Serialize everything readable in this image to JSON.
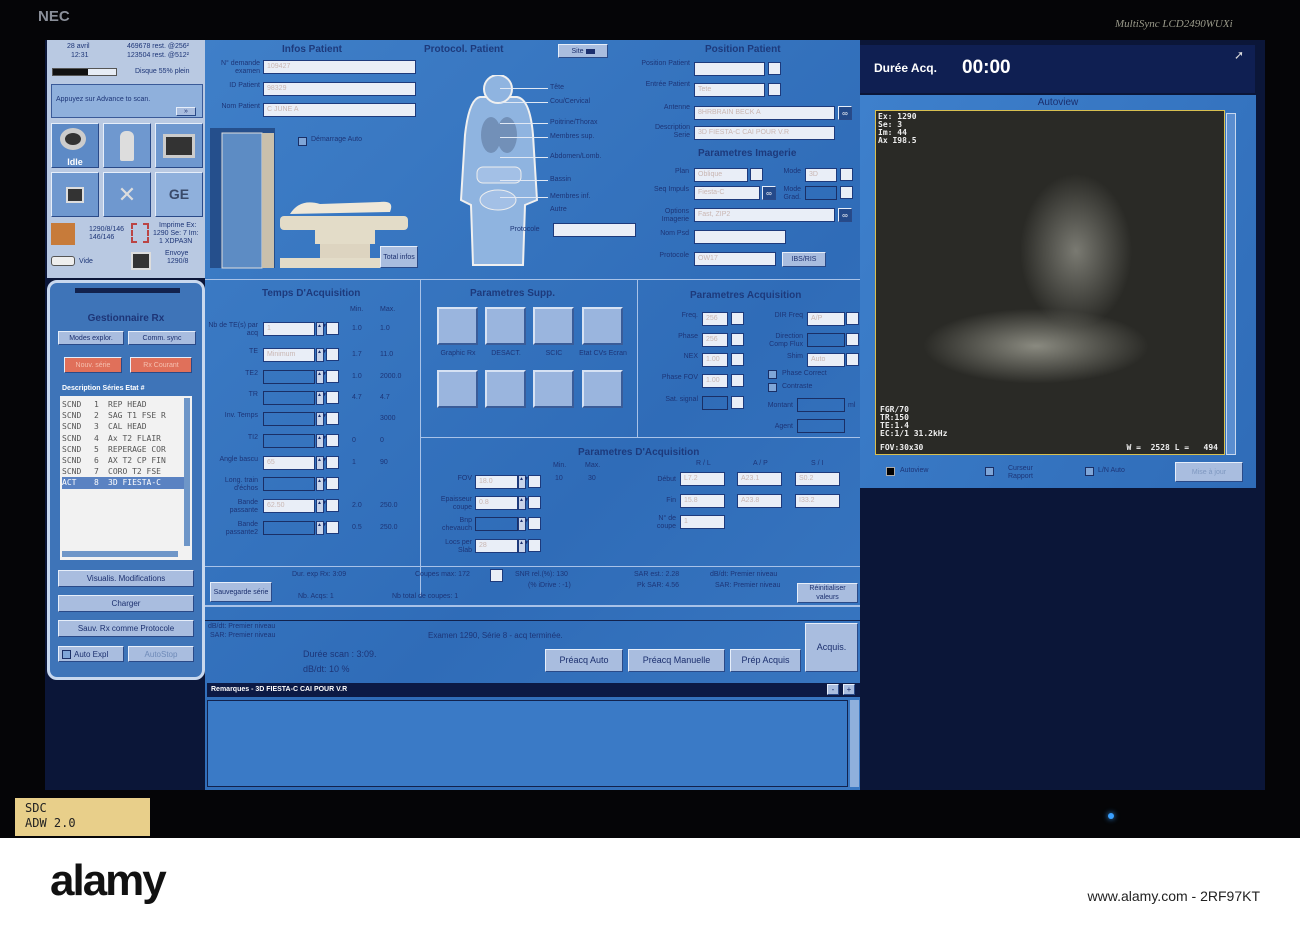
{
  "bezel": {
    "brand": "NEC",
    "model": "MultiSync LCD2490WUXi",
    "sticker_line1": "SDC",
    "sticker_line2": "ADW 2.0"
  },
  "watermark": {
    "logo": "alamy",
    "footer": "www.alamy.com - 2RF97KT"
  },
  "status_panel": {
    "date": "28 avril",
    "time": "12:31",
    "rest1": "469678 rest. @256²",
    "rest2": "123504 rest. @512²",
    "disk": "Disque 55% plein",
    "disk_fill": 55,
    "message": "Appuyez sur Advance to scan.",
    "advance": "»",
    "idle": "Idle",
    "ge": "GE",
    "exam_info1": "1290/8/146",
    "exam_info2": "146/146",
    "print1": "Imprime Ex:",
    "print2": "1290 Se: 7 Im:",
    "print3": "1 XDPA3N",
    "vide": "Vide",
    "send1": "Envoye",
    "send2": "1290/8"
  },
  "rx_manager": {
    "title": "Gestionnaire Rx",
    "modes": "Modes explor.",
    "sync": "Comm. sync",
    "btn_red1": "Nouv. série",
    "btn_red2": "Rx Courant",
    "list_header": "Description Séries Etat #",
    "series": [
      {
        "s": "SCND",
        "n": "1",
        "d": "REP HEAD"
      },
      {
        "s": "SCND",
        "n": "2",
        "d": "SAG T1 FSE R"
      },
      {
        "s": "SCND",
        "n": "3",
        "d": "CAL HEAD"
      },
      {
        "s": "SCND",
        "n": "4",
        "d": "Ax T2 FLAIR"
      },
      {
        "s": "SCND",
        "n": "5",
        "d": "REPERAGE COR"
      },
      {
        "s": "SCND",
        "n": "6",
        "d": "AX T2 CP FIN"
      },
      {
        "s": "SCND",
        "n": "7",
        "d": "CORO T2 FSE"
      },
      {
        "s": "ACT",
        "n": "8",
        "d": "3D FIESTA-C"
      }
    ],
    "visualis": "Visualis. Modifications",
    "charger": "Charger",
    "sauv": "Sauv. Rx comme Protocole",
    "auto_expl": "Auto Expl",
    "autostop": "AutoStop"
  },
  "patient": {
    "title": "Infos Patient",
    "fields": [
      {
        "label": "N° demande examen",
        "value": "109427"
      },
      {
        "label": "ID Patient",
        "value": "98329"
      },
      {
        "label": "Nom Patient",
        "value": "C JUNE A"
      }
    ],
    "demarrage": "Démarrage Auto",
    "total": "Total infos"
  },
  "protocol": {
    "title": "Protocol. Patient",
    "site": "Site",
    "regions": [
      "Tête",
      "Cou/Cervical",
      "Poitrine/Thorax",
      "Membres sup.",
      "Abdomen/Lomb.",
      "Bassin",
      "Membres inf.",
      "Autre"
    ],
    "protocole_label": "Protocole",
    "protocole_value": ""
  },
  "position": {
    "title": "Position Patient",
    "pos_label": "Position Patient",
    "pos_value": "",
    "entree_label": "Entrée Patient",
    "entree_value": "Tete",
    "antenne_label": "Antenne",
    "antenne_value": "8HRBRAIN BECK A",
    "desc_label": "Description Serie",
    "desc_value": "3D FIESTA-C CAI POUR V.R"
  },
  "imagerie": {
    "title": "Parametres Imagerie",
    "plan_label": "Plan",
    "plan_value": "Oblique",
    "mode_label": "Mode",
    "mode_value": "3D",
    "seq_label": "Seq Impuls",
    "seq_value": "Fiesta-C",
    "grad_label": "Mode Grad.",
    "options_label": "Options Imagerie",
    "options_value": "Fast, ZIP2",
    "nompsd_label": "Nom Psd",
    "protocole_label": "Protocole",
    "protocole_value": "OW17",
    "ris": "IBS/RIS"
  },
  "temps": {
    "title": "Temps D'Acquisition",
    "min": "Min.",
    "max": "Max.",
    "rows": [
      {
        "label": "Nb de TE(s) par acq",
        "value": "1",
        "min": "1.0",
        "max": "1.0"
      },
      {
        "label": "TE",
        "value": "Minimum",
        "min": "1.7",
        "max": "11.0"
      },
      {
        "label": "TE2",
        "value": "",
        "min": "1.0",
        "max": "2000.0"
      },
      {
        "label": "TR",
        "value": "",
        "min": "4.7",
        "max": "4.7"
      },
      {
        "label": "Inv. Temps",
        "value": "",
        "min": "",
        "max": "3000"
      },
      {
        "label": "TI2",
        "value": "",
        "min": "0",
        "max": "0"
      },
      {
        "label": "Angle bascu",
        "value": "65",
        "min": "1",
        "max": "90"
      },
      {
        "label": "Long. train d'échos",
        "value": "",
        "min": "",
        "max": ""
      },
      {
        "label": "Bande passante",
        "value": "62.50",
        "min": "2.0",
        "max": "250.0"
      },
      {
        "label": "Bande passante2",
        "value": "",
        "min": "0.5",
        "max": "250.0"
      }
    ]
  },
  "supp": {
    "title": "Parametres Supp.",
    "labels": [
      "Graphic Rx",
      "DESACT.",
      "SCIC",
      "Etat CVs Ecran"
    ]
  },
  "acq": {
    "title": "Parametres Acquisition",
    "left": [
      {
        "label": "Freq.",
        "value": "256"
      },
      {
        "label": "Phase",
        "value": "256"
      },
      {
        "label": "NEX",
        "value": "1.00"
      },
      {
        "label": "Phase FOV",
        "value": "1.00"
      },
      {
        "label": "Sat. signal",
        "value": ""
      }
    ],
    "dir_label": "DIR Freq",
    "dir_value": "A/P",
    "flux_label": "Direction Comp Flux",
    "shim_label": "Shim",
    "shim_value": "Auto",
    "phase_correct": "Phase Correct",
    "contraste": "Contraste",
    "montant": "Montant",
    "ml": "ml",
    "agent": "Agent"
  },
  "geo": {
    "title": "Parametres D'Acquisition",
    "min": "Min.",
    "max": "Max.",
    "min_v": "10",
    "max_v": "30",
    "rows": [
      {
        "label": "FOV",
        "value": "18.0"
      },
      {
        "label": "Epaisseur coupe",
        "value": "0.8"
      },
      {
        "label": "Bnp chevauch",
        "value": ""
      },
      {
        "label": "Locs per Slab",
        "value": "28"
      }
    ],
    "cols": [
      "R / L",
      "A / P",
      "S / I"
    ],
    "debut": "Début",
    "fin": "Fin",
    "debut_v": [
      "L7.2",
      "A23.1",
      "S0.2"
    ],
    "fin_v": [
      "15.8",
      "A23.8",
      "I33.2"
    ],
    "ncoupe": "N° de coupe",
    "ncoupe_v": "1"
  },
  "summary": {
    "dur": "Dur. exp Rx: 3:09",
    "coupes": "Coupes max: 172",
    "snr": "SNR rel.(%): 130",
    "idrive": "(% iDrive : -1)",
    "nbacq": "Nb. Acqs: 1",
    "nbtot": "Nb total de coupes: 1",
    "sar": "SAR est.: 2.28",
    "pksar": "Pk SAR: 4.56",
    "dbdt": "dB/dt: Premier niveau",
    "sarn": "SAR: Premier niveau",
    "reinit": "Réinitialiser valeurs",
    "sauvegarde": "Sauvegarde série"
  },
  "status": {
    "dbdt": "dB/dt: Premier niveau",
    "sar": "SAR: Premier niveau",
    "exam": "Examen 1290, Série 8 -  acq terminée.",
    "duree": "Durée scan :  3:09.",
    "dbdt2": "dB/dt:  10 %",
    "preacq_auto": "Préacq Auto",
    "preacq_man": "Préacq Manuelle",
    "prep": "Prép Acquis",
    "acquis": "Acquis."
  },
  "remarks": {
    "title": "Remarques - 3D FIESTA-C CAI POUR V.R",
    "minus": "-",
    "plus": "+",
    "text": ""
  },
  "autoview": {
    "duree_label": "Durée Acq.",
    "duree": "00:00",
    "title": "Autoview",
    "ex": "Ex: 1290",
    "se": "Se: 3",
    "im": "Im: 44",
    "ax": "Ax I98.5",
    "fgr": "FGR/70",
    "tr": "TR:150",
    "te": "TE:1.4",
    "ec": "EC:1/1 31.2kHz",
    "fov": "FOV:30x30",
    "wl": "W =  2528 L =   494",
    "cb_autoview": "Autoview",
    "cb_curseur": "Curseur Rapport",
    "cb_ln": "L/N Auto",
    "mise": "Mise à jour"
  }
}
